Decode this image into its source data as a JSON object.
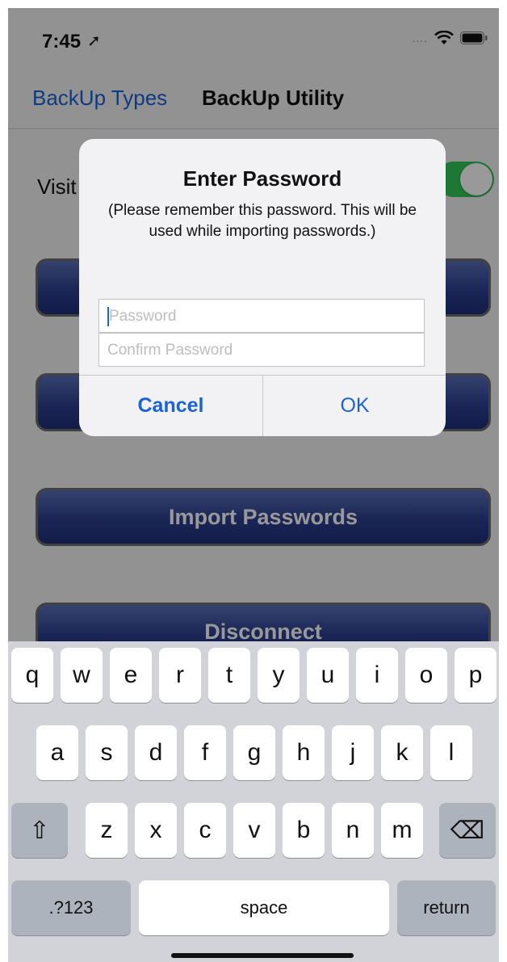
{
  "status": {
    "time": "7:45",
    "location_glyph": "➚",
    "signal": "....",
    "icons": [
      "location-icon",
      "signal-dots-icon",
      "wifi-icon",
      "battery-icon"
    ]
  },
  "nav": {
    "back_label": "BackUp Types",
    "title": "BackUp Utility"
  },
  "settings": {
    "visible_label": "Visit",
    "toggle_on": true
  },
  "buttons": {
    "button1_label": "",
    "button2_label": "",
    "import_label": "Import Passwords",
    "disconnect_label": "Disconnect"
  },
  "alert": {
    "title": "Enter Password",
    "message": "(Please remember this password. This will be used while importing passwords.)",
    "password_placeholder": "Password",
    "confirm_placeholder": "Confirm Password",
    "cancel_label": "Cancel",
    "ok_label": "OK"
  },
  "keyboard": {
    "row1": [
      "q",
      "w",
      "e",
      "r",
      "t",
      "y",
      "u",
      "i",
      "o",
      "p"
    ],
    "row2": [
      "a",
      "s",
      "d",
      "f",
      "g",
      "h",
      "j",
      "k",
      "l"
    ],
    "row3": [
      "z",
      "x",
      "c",
      "v",
      "b",
      "n",
      "m"
    ],
    "shift_glyph": "⇧",
    "delete_glyph": "⌫",
    "numbers_label": ".?123",
    "space_label": "space",
    "return_label": "return"
  },
  "colors": {
    "tint": "#1a62d8",
    "toggle_on": "#34c759",
    "button_blue": "#2c3f8f",
    "keyboard_bg": "#d1d3d9"
  }
}
